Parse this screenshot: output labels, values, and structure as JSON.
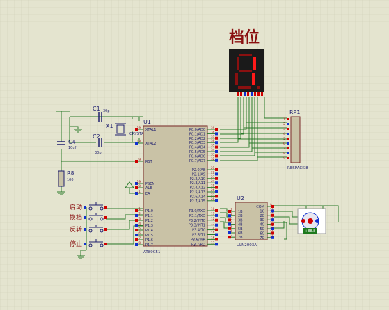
{
  "display": {
    "title": "档位",
    "digit": "1",
    "color_on": "#ff1a1a",
    "color_off": "#8a1010",
    "body_color": "#1a1a1a"
  },
  "colors": {
    "background": "#e4e4cf",
    "grid": "#cfcfb8",
    "wire": "#2a7a2a",
    "chip_fill": "#c9c2a6",
    "chip_border": "#7a2a2a",
    "pin_red": "#d00000",
    "pin_blue": "#1030d0",
    "label": "#1e1e6e",
    "pin_number": "#9a1a1a"
  },
  "u1": {
    "ref": "U1",
    "part": "AT89C51",
    "left_pins": [
      "XTAL1",
      "XTAL2",
      "RST",
      "PSEN",
      "ALE",
      "EA",
      "P1.0",
      "P1.1",
      "P1.2",
      "P1.3",
      "P1.4",
      "P1.5",
      "P1.6",
      "P1.7"
    ],
    "right_pins_p0": [
      "P0.0/AD0",
      "P0.1/AD1",
      "P0.2/AD2",
      "P0.3/AD3",
      "P0.4/AD4",
      "P0.5/AD5",
      "P0.6/AD6",
      "P0.7/AD7"
    ],
    "right_pins_p2": [
      "P2.0/A8",
      "P2.1/A9",
      "P2.2/A10",
      "P2.3/A11",
      "P2.4/A12",
      "P2.5/A13",
      "P2.6/A14",
      "P2.7/A15"
    ],
    "right_pins_p3": [
      "P3.0/RXD",
      "P3.1/TXD",
      "P3.2/INT0",
      "P3.3/INT1",
      "P3.4/T0",
      "P3.5/T1",
      "P3.6/WR",
      "P3.7/RD"
    ],
    "pin_nums_p0": [
      "39",
      "38",
      "37",
      "36",
      "35",
      "34",
      "33",
      "32"
    ],
    "pin_nums_p2": [
      "21",
      "22",
      "23",
      "24",
      "25",
      "26",
      "27",
      "28"
    ],
    "pin_nums_p3": [
      "10",
      "11",
      "12",
      "13",
      "14",
      "15",
      "16",
      "17"
    ],
    "pin_nums_left": [
      "19",
      "18",
      "9",
      "29",
      "30",
      "31",
      "1",
      "2",
      "3",
      "4",
      "5",
      "6",
      "7",
      "8"
    ]
  },
  "u2": {
    "ref": "U2",
    "part": "ULN2003A",
    "left_pins": [
      "1B",
      "2B",
      "3B",
      "4B",
      "5B",
      "6B",
      "7B"
    ],
    "right_pins": [
      "COM",
      "1C",
      "2C",
      "3C",
      "4C",
      "5C",
      "6C",
      "7C"
    ],
    "left_nums": [
      "1",
      "2",
      "3",
      "4",
      "5",
      "6",
      "7"
    ],
    "right_nums": [
      "9",
      "16",
      "15",
      "14",
      "13",
      "12",
      "11",
      "10"
    ]
  },
  "rp1": {
    "ref": "RP1",
    "part": "RESPACK-8",
    "pin_nums": [
      "1",
      "2",
      "3",
      "4",
      "5",
      "6",
      "7",
      "8",
      "9"
    ]
  },
  "c1": {
    "ref": "C1",
    "value": "30p"
  },
  "c2": {
    "ref": "C2",
    "value": "30p"
  },
  "c4": {
    "ref": "C4",
    "value": "10uf"
  },
  "r8": {
    "ref": "R8",
    "value": "100"
  },
  "x1": {
    "ref": "X1",
    "part": "CRYSTAL"
  },
  "buttons": [
    {
      "label": "启动"
    },
    {
      "label": "换档"
    },
    {
      "label": "反转"
    },
    {
      "label": "停止"
    }
  ],
  "motor": {
    "value": "+88.8"
  }
}
